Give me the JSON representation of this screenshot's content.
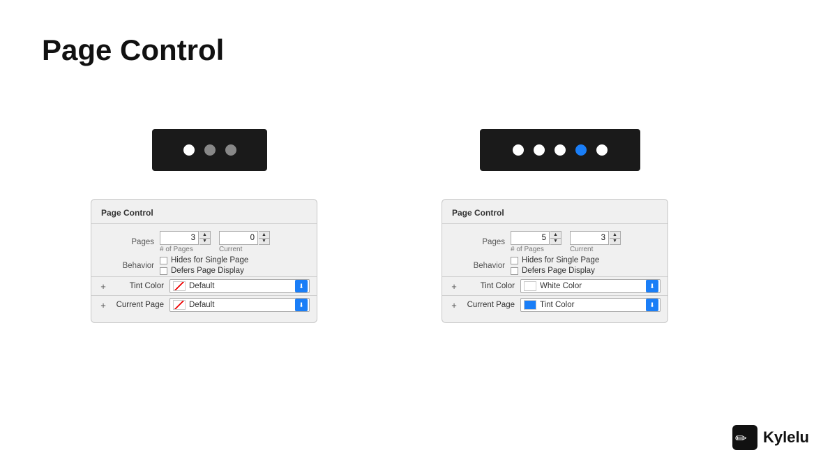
{
  "page": {
    "title": "Page Control",
    "background": "#ffffff"
  },
  "preview_left": {
    "dots": [
      "white",
      "gray",
      "gray"
    ]
  },
  "preview_right": {
    "dots": [
      "white",
      "white",
      "white",
      "blue",
      "white"
    ]
  },
  "panel_left": {
    "title": "Page Control",
    "pages_label": "Pages",
    "pages_count": "3",
    "pages_current": "0",
    "of_pages_label": "# of Pages",
    "current_label": "Current",
    "behavior_label": "Behavior",
    "hides_single": "Hides for Single Page",
    "defers_display": "Defers Page Display",
    "tint_color_label": "Tint Color",
    "tint_color_value": "Default",
    "current_page_label": "Current Page",
    "current_page_value": "Default",
    "plus_label": "+"
  },
  "panel_right": {
    "title": "Page Control",
    "pages_label": "Pages",
    "pages_count": "5",
    "pages_current": "3",
    "of_pages_label": "# of Pages",
    "current_label": "Current",
    "behavior_label": "Behavior",
    "hides_single": "Hides for Single Page",
    "defers_display": "Defers Page Display",
    "tint_color_label": "Tint Color",
    "tint_color_value": "White Color",
    "current_page_label": "Current Page",
    "current_page_value": "Tint Color",
    "plus_label": "+"
  },
  "brand": {
    "name": "Kylelu"
  },
  "stepper_up": "▲",
  "stepper_down": "▼"
}
